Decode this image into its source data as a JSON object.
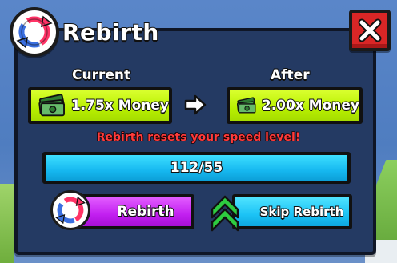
{
  "header": {
    "title": "Rebirth",
    "icon": "rebirth-swirl-icon",
    "close_icon": "close-x-icon"
  },
  "current": {
    "label": "Current",
    "value": "1.75x Money",
    "icon": "cash-stack-icon"
  },
  "after": {
    "label": "After",
    "value": "2.00x Money",
    "icon": "cash-stack-icon"
  },
  "warning": "Rebirth resets your speed level!",
  "progress": {
    "text": "112/55",
    "fraction": 1.0
  },
  "buttons": {
    "rebirth_label": "Rebirth",
    "skip_label": "Skip Rebirth"
  },
  "colors": {
    "panel": "#243a63",
    "close": "#d92626",
    "money_box": "#b8f000",
    "progress": "#16b8f0",
    "rebirth_btn": "#c21ff0",
    "skip_btn": "#1cc3f5",
    "warning": "#ff3b3b"
  }
}
